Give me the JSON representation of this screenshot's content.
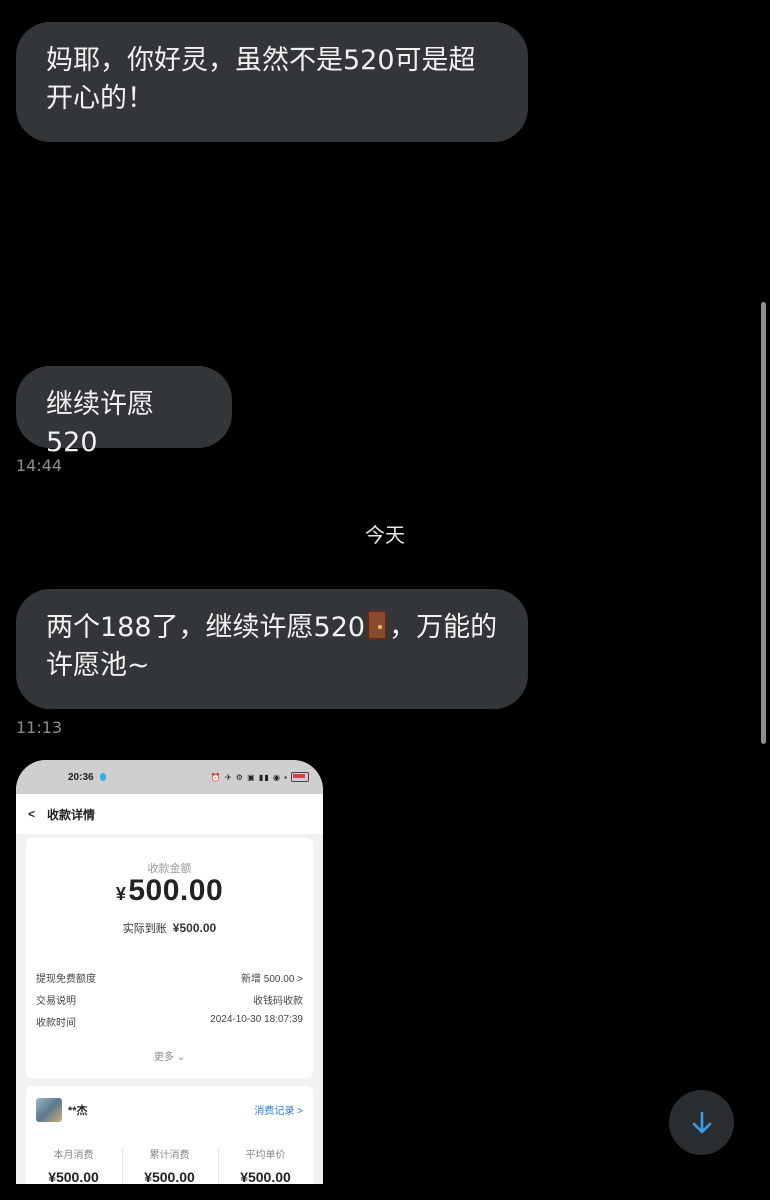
{
  "messages": [
    {
      "text": "妈耶，你好灵，虽然不是520可是超开心的！"
    },
    {
      "text": "继续许愿520",
      "time": "14:44"
    },
    {
      "text_before": "两个188了，继续许愿520",
      "emoji": "door",
      "text_after": "，万能的许愿池~",
      "time": "11:13"
    }
  ],
  "day_separator": "今天",
  "screenshot": {
    "status_time": "20:36",
    "status_icons": "⏰ ✈ ⚙ ▣ ▮▮ ◉ ▪",
    "nav_back": "<",
    "nav_title": "收款详情",
    "amount_label": "收款金额",
    "currency": "¥",
    "amount": "500.00",
    "net_label": "实际到账",
    "net_amount": "¥500.00",
    "rows": [
      {
        "key": "提现免费额度",
        "value": "新增 500.00 >"
      },
      {
        "key": "交易说明",
        "value": "收钱码收款"
      },
      {
        "key": "收款时间",
        "value": "2024-10-30 18:07:39"
      }
    ],
    "more": "更多",
    "payer": "**杰",
    "records_link": "消费记录 >",
    "stats": [
      {
        "label": "本月消费",
        "value": "¥500.00"
      },
      {
        "label": "累计消费",
        "value": "¥500.00"
      },
      {
        "label": "平均单价",
        "value": "¥500.00"
      }
    ]
  },
  "colors": {
    "bubble": "#333639",
    "link": "#2f7ae5",
    "fab_arrow": "#3b9cf0"
  },
  "icons": {
    "fab": "arrow-down-icon",
    "door": "door-emoji-icon"
  }
}
